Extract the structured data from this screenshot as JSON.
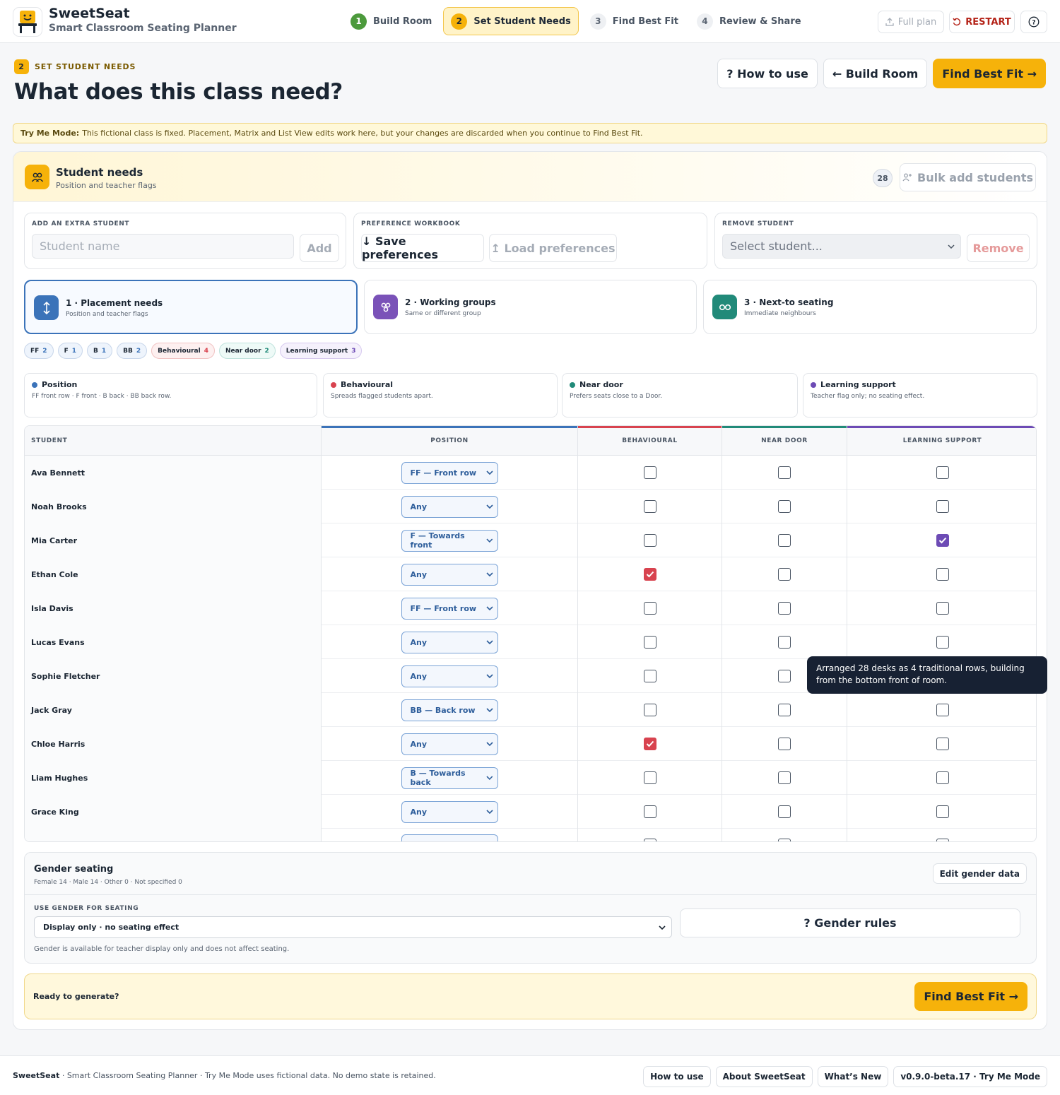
{
  "header": {
    "app_title": "SweetSeat",
    "app_subtitle": "Smart Classroom Seating Planner",
    "steps": [
      {
        "num": "1",
        "label": "Build Room"
      },
      {
        "num": "2",
        "label": "Set Student Needs"
      },
      {
        "num": "3",
        "label": "Find Best Fit"
      },
      {
        "num": "4",
        "label": "Review & Share"
      }
    ],
    "full_plan": "Full plan",
    "restart": "RESTART",
    "help_icon": "?"
  },
  "page": {
    "step_badge": "2",
    "eyebrow": "SET STUDENT NEEDS",
    "title": "What does this class need?",
    "how_to_use": "? How to use",
    "build_room": "← Build Room",
    "find_best_fit": "Find Best Fit →"
  },
  "banner": {
    "label": "Try Me Mode:",
    "text": "This fictional class is fixed. Placement, Matrix and List View edits work here, but your changes are discarded when you continue to Find Best Fit."
  },
  "card": {
    "title": "Student needs",
    "subtitle": "Position and teacher flags",
    "count": "28",
    "bulk_add": "Bulk add students"
  },
  "panels": {
    "add": {
      "label": "ADD AN EXTRA STUDENT",
      "placeholder": "Student name",
      "button": "Add"
    },
    "workbook": {
      "label": "PREFERENCE WORKBOOK",
      "save": "↓ Save preferences",
      "load": "↥ Load preferences"
    },
    "remove": {
      "label": "REMOVE STUDENT",
      "placeholder": "Select student...",
      "button": "Remove"
    }
  },
  "tabs": [
    {
      "title": "1 · Placement needs",
      "subtitle": "Position and teacher flags",
      "color": "#3b73b9"
    },
    {
      "title": "2 · Working groups",
      "subtitle": "Same or different group",
      "color": "#7a52b8"
    },
    {
      "title": "3 · Next-to seating",
      "subtitle": "Immediate neighbours",
      "color": "#218a79"
    }
  ],
  "chips": [
    {
      "label": "FF",
      "count": "2"
    },
    {
      "label": "F",
      "count": "1"
    },
    {
      "label": "B",
      "count": "1"
    },
    {
      "label": "BB",
      "count": "2"
    },
    {
      "label": "Behavioural",
      "count": "4"
    },
    {
      "label": "Near door",
      "count": "2"
    },
    {
      "label": "Learning support",
      "count": "3"
    }
  ],
  "legend": [
    {
      "title": "Position",
      "desc": "FF front row · F front · B back · BB back row.",
      "color": "#3b73b9"
    },
    {
      "title": "Behavioural",
      "desc": "Spreads flagged students apart.",
      "color": "#d8434f"
    },
    {
      "title": "Near door",
      "desc": "Prefers seats close to a Door.",
      "color": "#218a79"
    },
    {
      "title": "Learning support",
      "desc": "Teacher flag only; no seating effect.",
      "color": "#6d4bb5"
    }
  ],
  "table": {
    "headers": [
      "STUDENT",
      "POSITION",
      "BEHAVIOURAL",
      "NEAR DOOR",
      "LEARNING SUPPORT"
    ],
    "rows": [
      {
        "name": "Ava Bennett",
        "position": "FF — Front row",
        "behavioural": false,
        "near_door": false,
        "learning_support": false
      },
      {
        "name": "Noah Brooks",
        "position": "Any",
        "behavioural": false,
        "near_door": false,
        "learning_support": false
      },
      {
        "name": "Mia Carter",
        "position": "F — Towards front",
        "behavioural": false,
        "near_door": false,
        "learning_support": true
      },
      {
        "name": "Ethan Cole",
        "position": "Any",
        "behavioural": true,
        "near_door": false,
        "learning_support": false
      },
      {
        "name": "Isla Davis",
        "position": "FF — Front row",
        "behavioural": false,
        "near_door": false,
        "learning_support": false
      },
      {
        "name": "Lucas Evans",
        "position": "Any",
        "behavioural": false,
        "near_door": false,
        "learning_support": false
      },
      {
        "name": "Sophie Fletcher",
        "position": "Any",
        "behavioural": false,
        "near_door": false,
        "learning_support": false
      },
      {
        "name": "Jack Gray",
        "position": "BB — Back row",
        "behavioural": false,
        "near_door": false,
        "learning_support": false
      },
      {
        "name": "Chloe Harris",
        "position": "Any",
        "behavioural": true,
        "near_door": false,
        "learning_support": false
      },
      {
        "name": "Liam Hughes",
        "position": "B — Towards back",
        "behavioural": false,
        "near_door": false,
        "learning_support": false
      },
      {
        "name": "Grace King",
        "position": "Any",
        "behavioural": false,
        "near_door": false,
        "learning_support": false
      }
    ]
  },
  "tooltip": "Arranged 28 desks as 4 traditional rows, building from the bottom front of room.",
  "gender": {
    "title": "Gender seating",
    "summary": "Female 14 · Male 14 · Other 0 · Not specified 0",
    "edit": "Edit gender data",
    "label": "USE GENDER FOR SEATING",
    "selected": "Display only · no seating effect",
    "rules": "? Gender rules",
    "note": "Gender is available for teacher display only and does not affect seating."
  },
  "ready": {
    "text": "Ready to generate?",
    "button": "Find Best Fit →"
  },
  "footer": {
    "brand": "SweetSeat",
    "text": " · Smart Classroom Seating Planner · Try Me Mode uses fictional data. No demo state is retained.",
    "links": [
      "How to use",
      "About SweetSeat",
      "What’s New",
      "v0.9.0-beta.17 · Try Me Mode"
    ]
  }
}
